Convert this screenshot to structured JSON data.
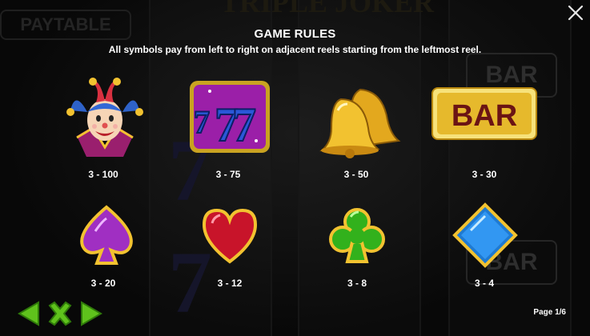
{
  "background": {
    "paytable_label": "PAYTABLE",
    "game_title": "TRIPLE JOKER",
    "bar_label": "BAR"
  },
  "header": {
    "title": "GAME RULES",
    "subtitle": "All symbols pay from left to right on adjacent reels starting from the leftmost reel."
  },
  "symbols": [
    {
      "name": "joker",
      "pay": "3 - 100"
    },
    {
      "name": "seven",
      "pay": "3 - 75"
    },
    {
      "name": "bell",
      "pay": "3 - 50"
    },
    {
      "name": "bar",
      "pay": "3 - 30",
      "label": "BAR"
    },
    {
      "name": "spade",
      "pay": "3 - 20"
    },
    {
      "name": "heart",
      "pay": "3 - 12"
    },
    {
      "name": "club",
      "pay": "3 - 8"
    },
    {
      "name": "diamond",
      "pay": "3 - 4"
    }
  ],
  "footer": {
    "page_indicator": "Page 1/6"
  },
  "icons": {
    "close": "close-icon",
    "prev": "arrow-left-icon",
    "close_green": "close-icon",
    "next": "arrow-right-icon"
  },
  "colors": {
    "nav_green": "#5fc21c",
    "gold": "#f2c230",
    "text": "#ffffff"
  }
}
